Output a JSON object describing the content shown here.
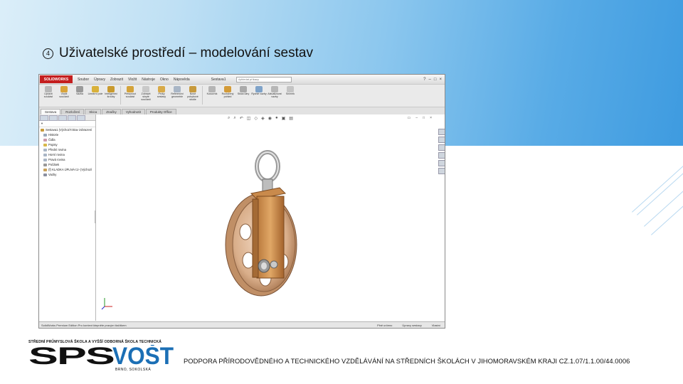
{
  "slide": {
    "title_marker": "4",
    "title": "Uživatelské prostředí – modelování sestav",
    "footer": "PODPORA PŘÍRODOVĚDNÉHO A TECHNICKÉHO VZDĚLÁVÁNÍ NA STŘEDNÍCH ŠKOLÁCH V JIHOMORAVSKÉM KRAJI CZ.1.07/1.1.00/44.0006"
  },
  "logo": {
    "top_text": "STŘEDNÍ PRŮMYSLOVÁ ŠKOLA A VYŠŠÍ ODBORNÁ ŠKOLA TECHNICKÁ",
    "main_text": "SPŠ VOŠT",
    "bottom_text": "BRNO, SOKOLSKÁ",
    "color": "#1b6fb5"
  },
  "solidworks": {
    "app_name": "SOLIDWORKS",
    "menu": [
      "Soubor",
      "Úpravy",
      "Zobrazit",
      "Vložit",
      "Nástroje",
      "Okno",
      "Nápověda"
    ],
    "document_title": "Sestava1",
    "search_placeholder": "Vyhledat příkazy",
    "ribbon": [
      {
        "label": "Upravit součást",
        "icon": "edit-part-icon",
        "color": "#b8b8b8"
      },
      {
        "label": "Vložit součásti",
        "icon": "insert-component-icon",
        "color": "#d9a43a"
      },
      {
        "label": "Vazba",
        "icon": "mate-icon",
        "color": "#9a9a9a"
      },
      {
        "label": "Lineární pole",
        "icon": "linear-pattern-icon",
        "color": "#d9b13a"
      },
      {
        "label": "Inteligentní šrouby",
        "icon": "smart-fasteners-icon",
        "color": "#c99a2e"
      },
      {
        "label": "Přesunout součást",
        "icon": "move-component-icon",
        "color": "#d4a33a"
      },
      {
        "label": "Zobrazit skryté součásti",
        "icon": "show-hidden-icon",
        "color": "#c9c9c9"
      },
      {
        "label": "Prvky sestavy",
        "icon": "assembly-features-icon",
        "color": "#d8aa48"
      },
      {
        "label": "Referenční geometrie",
        "icon": "reference-geometry-icon",
        "color": "#a9b6c6"
      },
      {
        "label": "Nové pohybové studie",
        "icon": "motion-study-icon",
        "color": "#c79a3c"
      },
      {
        "label": "Kusovník",
        "icon": "bom-icon",
        "color": "#b5b5b5"
      },
      {
        "label": "Rozložený pohled",
        "icon": "exploded-view-icon",
        "color": "#d39b38"
      },
      {
        "label": "Skica čáry",
        "icon": "explode-line-icon",
        "color": "#aaaaaa"
      },
      {
        "label": "Rychlé vazby",
        "icon": "instant3d-icon",
        "color": "#7fa3c9"
      },
      {
        "label": "Aktualizovat vazby",
        "icon": "update-icon",
        "color": "#b7b7b7"
      },
      {
        "label": "Snímek",
        "icon": "snapshot-icon",
        "color": "#c4c4c4"
      }
    ],
    "tabs": [
      "Sestava",
      "Rozložení",
      "Skica",
      "Značky",
      "Vyhodnotit",
      "Produkty Office"
    ],
    "active_tab": "Sestava",
    "filter_label": "▼",
    "tree": [
      {
        "label": "Sestava1 (Výchozí<Stav zobrazení",
        "color": "#c79b3a"
      },
      {
        "label": "Historie",
        "color": "#9ab"
      },
      {
        "label": "Čidla",
        "color": "#c9a"
      },
      {
        "label": "Popisy",
        "color": "#d8b84a"
      },
      {
        "label": "Přední rovina",
        "color": "#a9b6c6"
      },
      {
        "label": "Horní rovina",
        "color": "#a9b6c6"
      },
      {
        "label": "Pravá rovina",
        "color": "#a9b6c6"
      },
      {
        "label": "Počátek",
        "color": "#999"
      },
      {
        "label": "(f) KLADKA ÚPLNÁ<1> (Výchozí",
        "color": "#c9a15a"
      },
      {
        "label": "Vazby",
        "color": "#8a8fa0"
      }
    ],
    "status_left": "SolidWorks Premium Edition    Pro kontext klepněte pravým tlačítkem",
    "status_right": [
      "Plně určeno",
      "Úpravy sestavy",
      "Vlastní"
    ]
  }
}
